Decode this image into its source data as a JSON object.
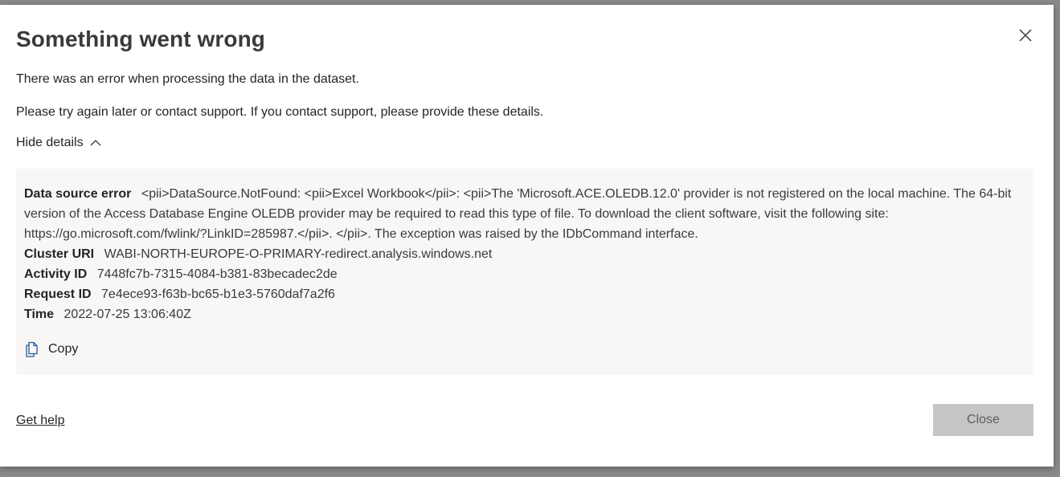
{
  "dialog": {
    "title": "Something went wrong",
    "message1": "There was an error when processing the data in the dataset.",
    "message2": "Please try again later or contact support. If you contact support, please provide these details.",
    "toggle_label": "Hide details"
  },
  "details": {
    "data_source_error_label": "Data source error",
    "data_source_error_value": "<pii>DataSource.NotFound: <pii>Excel Workbook</pii>: <pii>The 'Microsoft.ACE.OLEDB.12.0' provider is not registered on the local machine. The 64-bit version of the Access Database Engine OLEDB provider may be required to read this type of file. To download the client software, visit the following site: https://go.microsoft.com/fwlink/?LinkID=285987.</pii>. </pii>. The exception was raised by the IDbCommand interface.",
    "cluster_uri_label": "Cluster URI",
    "cluster_uri_value": "WABI-NORTH-EUROPE-O-PRIMARY-redirect.analysis.windows.net",
    "activity_id_label": "Activity ID",
    "activity_id_value": "7448fc7b-7315-4084-b381-83becadec2de",
    "request_id_label": "Request ID",
    "request_id_value": "7e4ece93-f63b-bc65-b1e3-5760daf7a2f6",
    "time_label": "Time",
    "time_value": "2022-07-25 13:06:40Z",
    "copy_label": "Copy"
  },
  "footer": {
    "get_help_label": "Get help",
    "close_label": "Close"
  },
  "icons": {
    "close": "close-icon",
    "chevron": "chevron-up-icon",
    "copy": "copy-icon"
  },
  "colors": {
    "details_bg": "#f8f7f6",
    "close_button_bg": "#c8c6c4",
    "text": "#252423"
  }
}
